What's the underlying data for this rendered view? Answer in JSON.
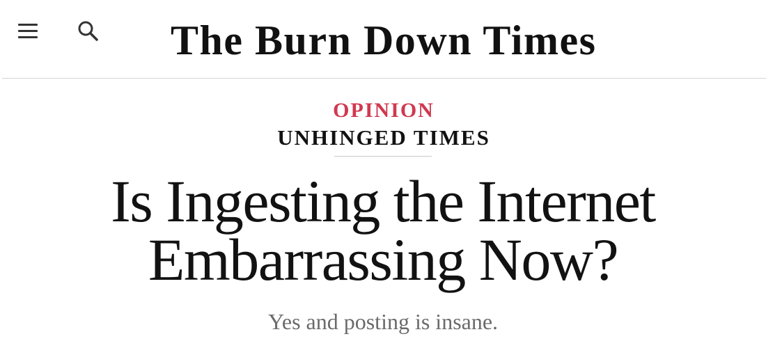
{
  "header": {
    "menu_icon": "hamburger-menu-icon",
    "search_icon": "search-icon",
    "logo_text": "The Burn Down Times"
  },
  "article": {
    "section": "OPINION",
    "column": "UNHINGED TIMES",
    "headline": "Is Ingesting the Internet Embarrassing Now?",
    "subheadline": "Yes and posting is insane."
  },
  "colors": {
    "section_accent": "#d0384f",
    "text": "#121212",
    "subheadline": "#6b6b6b"
  }
}
